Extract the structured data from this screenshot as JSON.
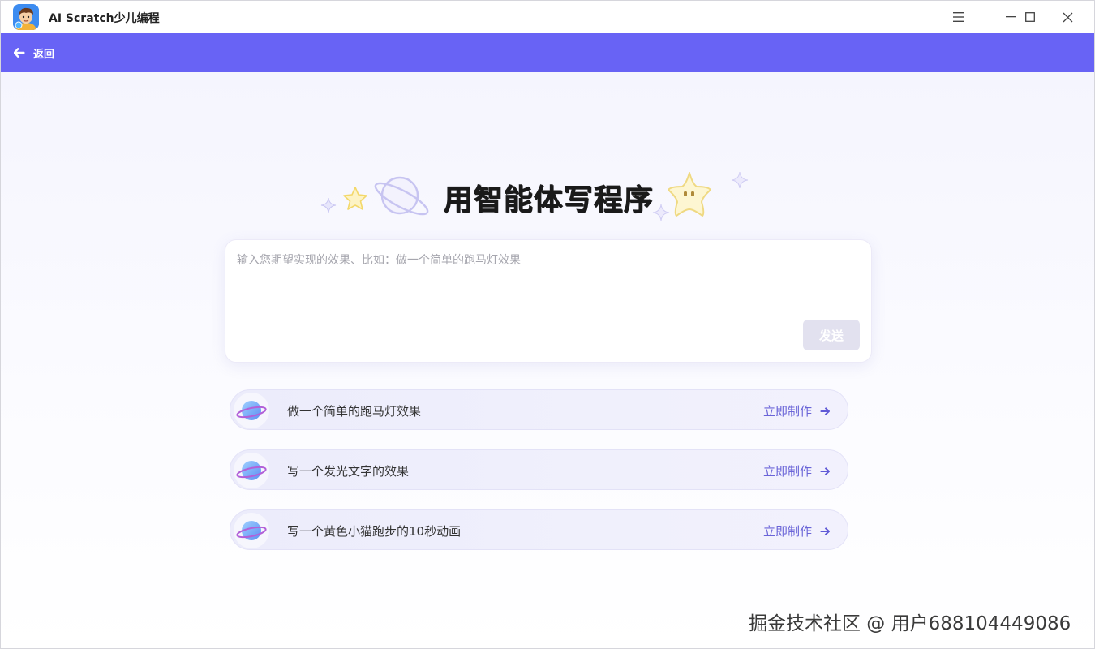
{
  "window": {
    "app_title": "AI Scratch少儿编程",
    "app_icon": "kid-avatar-icon"
  },
  "nav": {
    "back_label": "返回",
    "accent": "#6863f5"
  },
  "hero": {
    "title": "用智能体写程序"
  },
  "prompt": {
    "placeholder": "输入您期望实现的效果、比如：做一个简单的跑马灯效果",
    "value": "",
    "send_label": "发送"
  },
  "suggestions": [
    {
      "label": "做一个简单的跑马灯效果",
      "action": "立即制作"
    },
    {
      "label": "写一个发光文字的效果",
      "action": "立即制作"
    },
    {
      "label": "写一个黄色小猫跑步的10秒动画",
      "action": "立即制作"
    }
  ],
  "watermark": "掘金技术社区 @ 用户688104449086"
}
